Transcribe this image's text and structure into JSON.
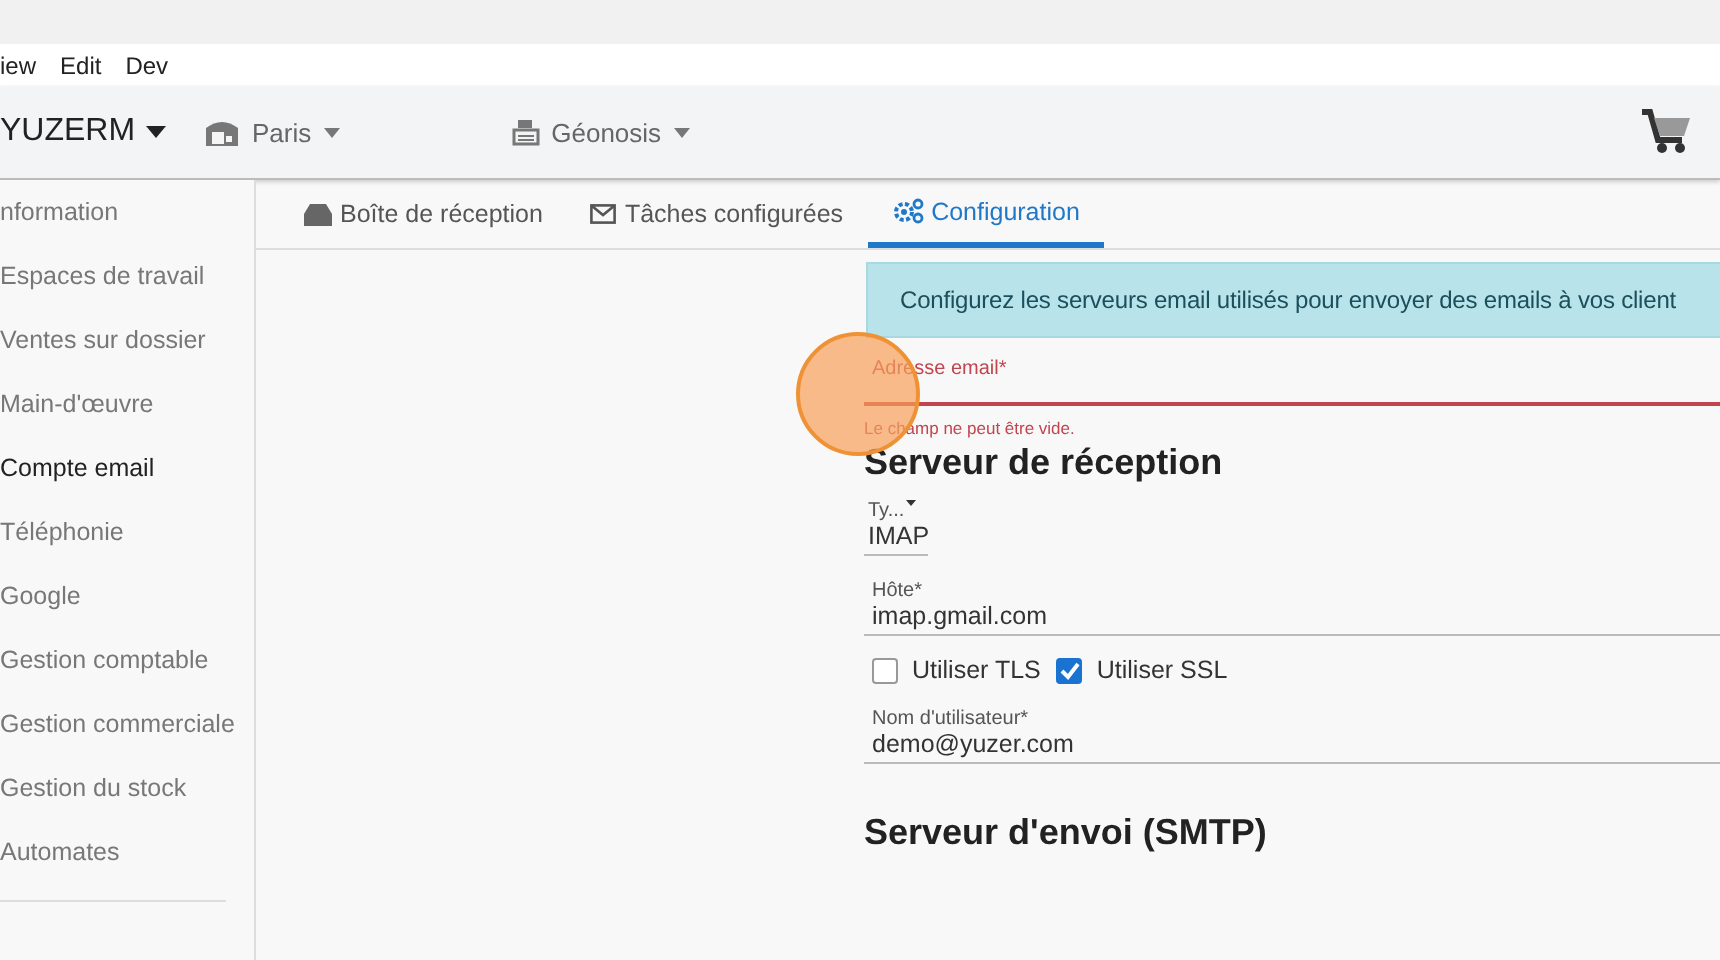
{
  "menu": [
    "iew",
    "Edit",
    "Dev"
  ],
  "header": {
    "company": "YUZERM",
    "site": "Paris",
    "workshop": "Géonosis"
  },
  "sidebar": {
    "items": [
      {
        "label": "nformation",
        "selected": false
      },
      {
        "label": "Espaces de travail",
        "selected": false
      },
      {
        "label": "Ventes sur dossier",
        "selected": false
      },
      {
        "label": "Main-d'œuvre",
        "selected": false
      },
      {
        "label": "Compte email",
        "selected": true
      },
      {
        "label": "Téléphonie",
        "selected": false
      },
      {
        "label": "Google",
        "selected": false
      },
      {
        "label": "Gestion comptable",
        "selected": false
      },
      {
        "label": "Gestion commerciale",
        "selected": false
      },
      {
        "label": "Gestion du stock",
        "selected": false
      },
      {
        "label": "Automates",
        "selected": false
      }
    ]
  },
  "tabs": [
    {
      "label": "Boîte de réception",
      "kind": "inbox",
      "selected": false
    },
    {
      "label": "Tâches configurées",
      "kind": "envelope",
      "selected": false
    },
    {
      "label": "Configuration",
      "kind": "gears",
      "selected": true
    }
  ],
  "info": "Configurez les serveurs email utilisés pour envoyer des emails à vos client",
  "email_field": {
    "label": "Adresse email*",
    "error": "Le champ ne peut être vide."
  },
  "reception": {
    "title": "Serveur de réception",
    "type_label": "Ty...",
    "type_value": "IMAP",
    "host_label": "Hôte*",
    "host_value": "imap.gmail.com",
    "options": [
      {
        "label": "Utiliser TLS",
        "checked": false
      },
      {
        "label": "Utiliser SSL",
        "checked": true
      }
    ],
    "user_label": "Nom d'utilisateur*",
    "user_value": "demo@yuzer.com"
  },
  "smtp_title": "Serveur d'envoi (SMTP)"
}
